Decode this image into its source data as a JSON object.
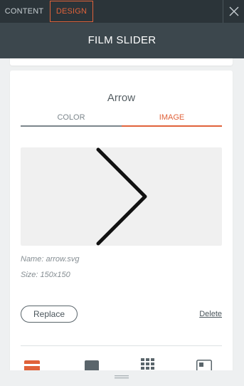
{
  "tabs": {
    "content": "CONTENT",
    "design": "DESIGN"
  },
  "title": "FILM SLIDER",
  "section": {
    "title": "Arrow",
    "subtabs": {
      "color": "COLOR",
      "image": "IMAGE"
    },
    "active_subtab": "image",
    "file": {
      "name_text": "Name: arrow.svg",
      "size_text": "Size: 150x150"
    },
    "replace_label": "Replace",
    "delete_label": "Delete"
  },
  "layout_options": [
    {
      "icon": "layout-banner-icon",
      "selected": true
    },
    {
      "icon": "layout-fill-icon",
      "selected": false
    },
    {
      "icon": "layout-grid-icon",
      "selected": false
    },
    {
      "icon": "layout-corner-icon",
      "selected": false
    }
  ],
  "colors": {
    "accent": "#e0623a",
    "tabbar": "#2b3439",
    "titlebar": "#3c474d"
  }
}
